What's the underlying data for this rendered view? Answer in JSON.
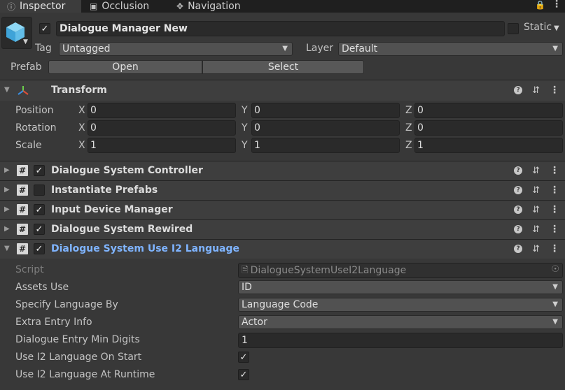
{
  "tabs": [
    {
      "label": "Inspector",
      "icon": "info-icon"
    },
    {
      "label": "Occlusion",
      "icon": "occlusion-icon"
    },
    {
      "label": "Navigation",
      "icon": "navigation-icon"
    }
  ],
  "gameobject": {
    "name": "Dialogue Manager New",
    "active": true,
    "static_label": "Static",
    "tag_label": "Tag",
    "tag_value": "Untagged",
    "layer_label": "Layer",
    "layer_value": "Default",
    "prefab_label": "Prefab",
    "open_label": "Open",
    "select_label": "Select"
  },
  "transform": {
    "title": "Transform",
    "rows": [
      {
        "label": "Position",
        "x": "0",
        "y": "0",
        "z": "0"
      },
      {
        "label": "Rotation",
        "x": "0",
        "y": "0",
        "z": "0"
      },
      {
        "label": "Scale",
        "x": "1",
        "y": "1",
        "z": "1"
      }
    ],
    "axis_x": "X",
    "axis_y": "Y",
    "axis_z": "Z"
  },
  "components": [
    {
      "title": "Dialogue System Controller",
      "enabled": true
    },
    {
      "title": "Instantiate Prefabs",
      "enabled": false
    },
    {
      "title": "Input Device Manager",
      "enabled": true
    },
    {
      "title": "Dialogue System Rewired",
      "enabled": true
    },
    {
      "title": "Dialogue System Use I2 Language",
      "enabled": true,
      "selected": true
    }
  ],
  "i2": {
    "script_label": "Script",
    "script_value": "DialogueSystemUseI2Language",
    "assets_use_label": "Assets Use",
    "assets_use_value": "ID",
    "specify_label": "Specify Language By",
    "specify_value": "Language Code",
    "extra_label": "Extra Entry Info",
    "extra_value": "Actor",
    "min_digits_label": "Dialogue Entry Min Digits",
    "min_digits_value": "1",
    "on_start_label": "Use I2 Language On Start",
    "on_start_value": true,
    "at_runtime_label": "Use I2 Language At Runtime",
    "at_runtime_value": true
  },
  "colors": {
    "background": "#383838",
    "field": "#2a2a2a",
    "highlight": "#7fb4ff"
  }
}
